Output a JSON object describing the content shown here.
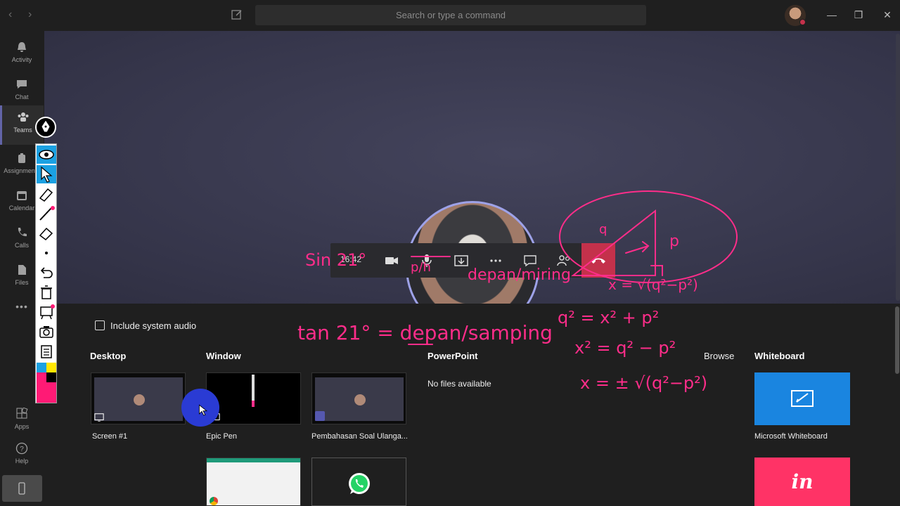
{
  "titlebar": {
    "search_placeholder": "Search or type a command",
    "nav_back": "‹",
    "nav_forward": "›",
    "win_minimize": "—",
    "win_restore": "❐",
    "win_close": "✕"
  },
  "rail": {
    "items": [
      {
        "label": "Activity",
        "icon": "bell-icon"
      },
      {
        "label": "Chat",
        "icon": "chat-icon"
      },
      {
        "label": "Teams",
        "icon": "teams-icon",
        "active": true
      },
      {
        "label": "Assignments",
        "icon": "assignments-icon"
      },
      {
        "label": "Calendar",
        "icon": "calendar-icon"
      },
      {
        "label": "Calls",
        "icon": "phone-icon"
      },
      {
        "label": "Files",
        "icon": "files-icon"
      }
    ],
    "more": "•••",
    "apps_label": "Apps",
    "help_label": "Help"
  },
  "call": {
    "time": "16:42"
  },
  "share_tray": {
    "include_audio_label": "Include system audio",
    "sections": {
      "desktop": "Desktop",
      "window": "Window",
      "powerpoint": "PowerPoint",
      "browse": "Browse",
      "whiteboard": "Whiteboard"
    },
    "desktop_items": [
      {
        "label": "Screen #1"
      }
    ],
    "window_items": [
      {
        "label": "Epic Pen"
      },
      {
        "label": "Pembahasan Soal Ulanga..."
      }
    ],
    "powerpoint_empty": "No files available",
    "whiteboard_items": [
      {
        "label": "Microsoft Whiteboard"
      }
    ],
    "invision_glyph": "in"
  },
  "ink_annotations": [
    "Sin 21°",
    "p/h",
    "depan/miring",
    "tan 21° = depan/samping",
    "q",
    "p",
    "x = √(q²−p²)",
    "q² = x² + p²",
    "x² = q² − p²",
    "x = ± √(q²−p²)"
  ],
  "colors": {
    "accent": "#6264a7",
    "ink": "#ff2d8a",
    "hangup": "#c4314b",
    "whiteboard_tile": "#1a85e0",
    "invision_tile": "#ff3366",
    "epic_selected": "#1ba1e2"
  }
}
